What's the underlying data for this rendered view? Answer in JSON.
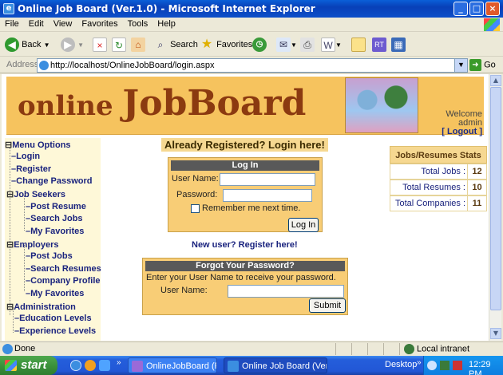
{
  "window": {
    "title": "Online Job Board (Ver.1.0) - Microsoft Internet Explorer"
  },
  "menubar": [
    "File",
    "Edit",
    "View",
    "Favorites",
    "Tools",
    "Help"
  ],
  "toolbar": {
    "back_label": "Back",
    "search_label": "Search",
    "favorites_label": "Favorites"
  },
  "address": {
    "label": "Address",
    "url": "http://localhost/OnlineJobBoard/login.aspx",
    "go_label": "Go"
  },
  "banner": {
    "logo_part1": "online ",
    "logo_part2": "JobBoard",
    "welcome": "Welcome",
    "user": "admin",
    "logout": "[ Logout ]"
  },
  "menu": {
    "title": "Menu Options",
    "items": [
      {
        "label": "Login"
      },
      {
        "label": "Register"
      },
      {
        "label": "Change Password"
      },
      {
        "label": "Job Seekers"
      },
      {
        "label": "Post Resume"
      },
      {
        "label": "Search Jobs"
      },
      {
        "label": "My Favorites"
      },
      {
        "label": "Employers"
      },
      {
        "label": "Post Jobs"
      },
      {
        "label": "Search Resumes"
      },
      {
        "label": "Company Profile"
      },
      {
        "label": "My Favorites"
      },
      {
        "label": "Administration"
      },
      {
        "label": "Education Levels"
      },
      {
        "label": "Experience Levels"
      }
    ]
  },
  "login": {
    "heading": "Already Registered? Login here!",
    "panel_title": "Log In",
    "username_label": "User Name:",
    "password_label": "Password:",
    "remember_label": "Remember me next time.",
    "login_button": "Log In",
    "username_value": "",
    "password_value": ""
  },
  "register_link": "New user? Register here!",
  "forgot": {
    "panel_title": "Forgot Your Password?",
    "instruction": "Enter your User Name to receive your password.",
    "username_label": "User Name:",
    "username_value": "",
    "submit_button": "Submit"
  },
  "stats": {
    "title": "Jobs/Resumes Stats",
    "rows": [
      {
        "label": "Total Jobs :",
        "value": "12"
      },
      {
        "label": "Total Resumes :",
        "value": "10"
      },
      {
        "label": "Total Companies :",
        "value": "11"
      }
    ]
  },
  "statusbar": {
    "status": "Done",
    "zone": "Local intranet"
  },
  "taskbar": {
    "start": "start",
    "tasks": [
      "OnlineJobBoard (Run...",
      "Online Job Board (Ver..."
    ],
    "desktop": "Desktop",
    "time": "12:29 PM"
  },
  "colors": {
    "banner": "#f6c35e",
    "panel": "#f8cd76",
    "menu_text": "#1a237e",
    "logo": "#8b3a10"
  }
}
